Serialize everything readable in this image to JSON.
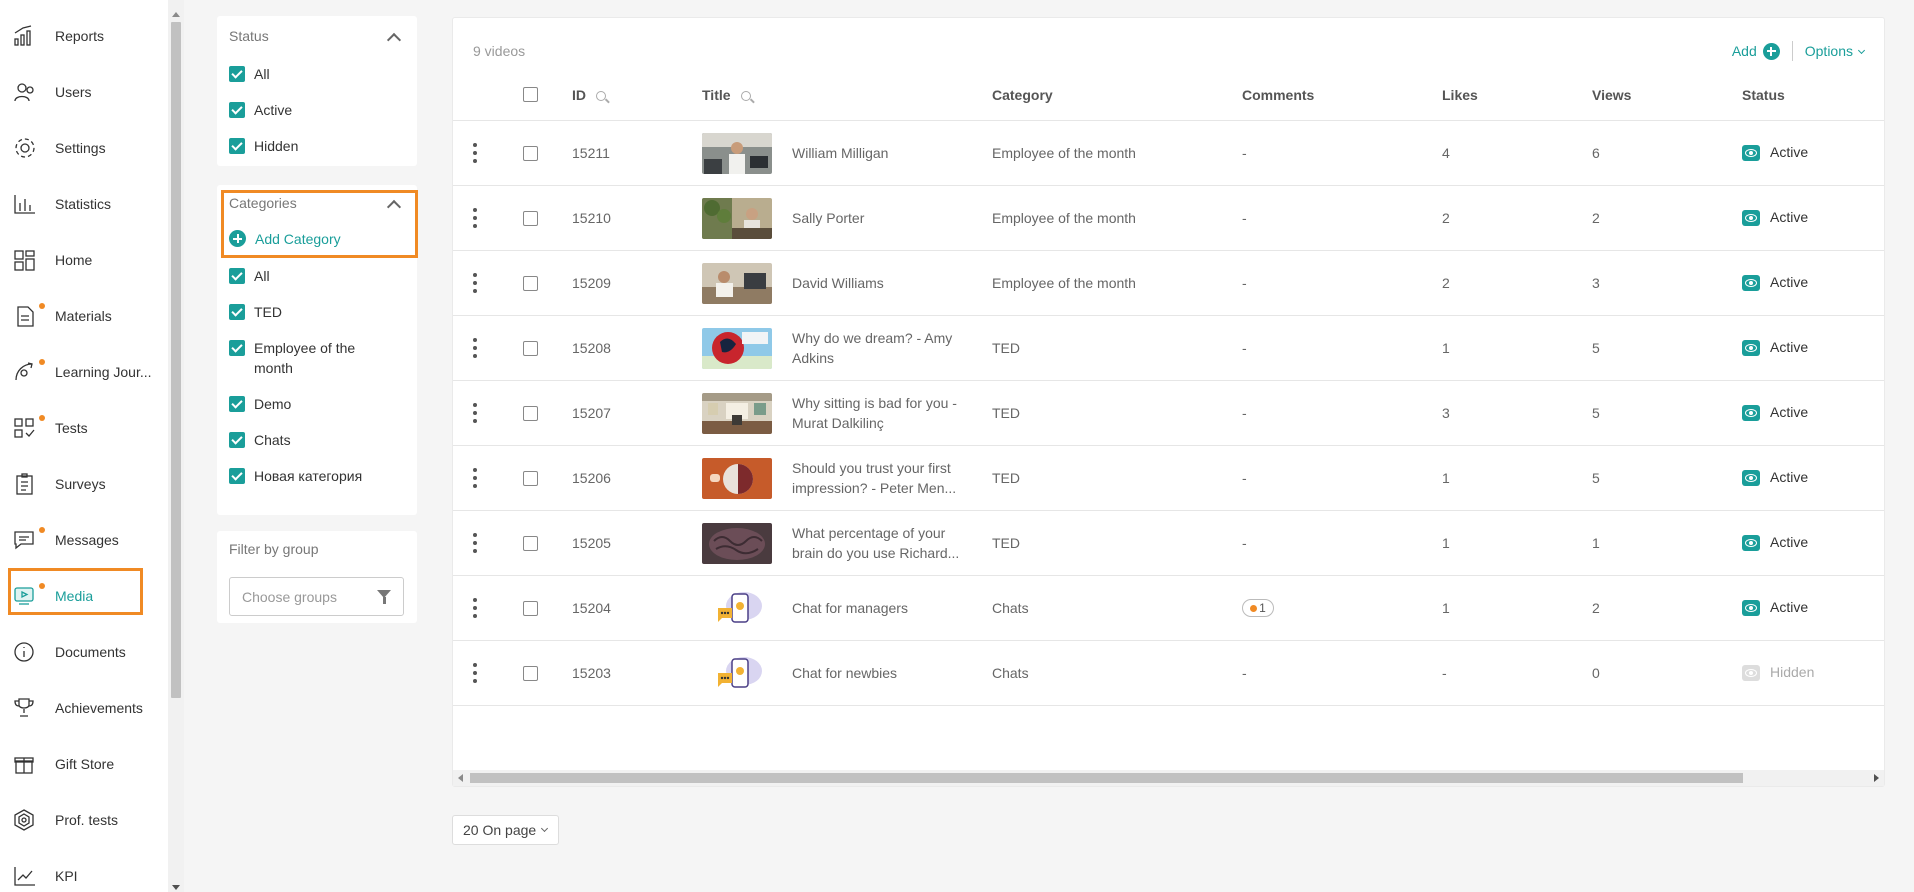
{
  "sidebar": {
    "items": [
      {
        "label": "Reports",
        "icon": "reports-icon",
        "dot": false
      },
      {
        "label": "Users",
        "icon": "users-icon",
        "dot": false
      },
      {
        "label": "Settings",
        "icon": "gear-icon",
        "dot": false
      },
      {
        "label": "Statistics",
        "icon": "bar-chart-icon",
        "dot": false
      },
      {
        "label": "Home",
        "icon": "home-layout-icon",
        "dot": false
      },
      {
        "label": "Materials",
        "icon": "materials-icon",
        "dot": true
      },
      {
        "label": "Learning Jour...",
        "icon": "learning-journey-icon",
        "dot": true
      },
      {
        "label": "Tests",
        "icon": "tests-icon",
        "dot": true
      },
      {
        "label": "Surveys",
        "icon": "surveys-icon",
        "dot": false
      },
      {
        "label": "Messages",
        "icon": "message-icon",
        "dot": true
      },
      {
        "label": "Media",
        "icon": "media-icon",
        "dot": true,
        "active": true
      },
      {
        "label": "Documents",
        "icon": "info-icon",
        "dot": false
      },
      {
        "label": "Achievements",
        "icon": "trophy-icon",
        "dot": false
      },
      {
        "label": "Gift Store",
        "icon": "gift-icon",
        "dot": false
      },
      {
        "label": "Prof. tests",
        "icon": "hexagon-icon",
        "dot": false
      },
      {
        "label": "KPI",
        "icon": "trend-icon",
        "dot": false
      }
    ]
  },
  "filters": {
    "status": {
      "title": "Status",
      "options": [
        "All",
        "Active",
        "Hidden"
      ]
    },
    "categories": {
      "title": "Categories",
      "add_label": "Add Category",
      "options": [
        "All",
        "TED",
        "Employee of the month",
        "Demo",
        "Chats",
        "Новая категория"
      ]
    },
    "group": {
      "title": "Filter by group",
      "placeholder": "Choose groups"
    }
  },
  "table": {
    "count": "9 videos",
    "add_label": "Add",
    "options_label": "Options",
    "columns": [
      "ID",
      "Title",
      "Category",
      "Comments",
      "Likes",
      "Views",
      "Status"
    ],
    "rows": [
      {
        "id": "15211",
        "title": "William Milligan",
        "category": "Employee of the month",
        "comments": "-",
        "likes": "4",
        "views": "6",
        "status": "Active",
        "thumb": "office"
      },
      {
        "id": "15210",
        "title": "Sally Porter",
        "category": "Employee of the month",
        "comments": "-",
        "likes": "2",
        "views": "2",
        "status": "Active",
        "thumb": "plants"
      },
      {
        "id": "15209",
        "title": "David Williams",
        "category": "Employee of the month",
        "comments": "-",
        "likes": "2",
        "views": "3",
        "status": "Active",
        "thumb": "desk"
      },
      {
        "id": "15208",
        "title": "Why do we dream? - Amy Adkins",
        "category": "TED",
        "comments": "-",
        "likes": "1",
        "views": "5",
        "status": "Active",
        "thumb": "dream"
      },
      {
        "id": "15207",
        "title": "Why sitting is bad for you - Murat Dalkilinç",
        "category": "TED",
        "comments": "-",
        "likes": "3",
        "views": "5",
        "status": "Active",
        "thumb": "room"
      },
      {
        "id": "15206",
        "title": "Should you trust your first impression? - Peter Men...",
        "category": "TED",
        "comments": "-",
        "likes": "1",
        "views": "5",
        "status": "Active",
        "thumb": "impression"
      },
      {
        "id": "15205",
        "title": "What percentage of your brain do you use Richard...",
        "category": "TED",
        "comments": "-",
        "likes": "1",
        "views": "1",
        "status": "Active",
        "thumb": "brain"
      },
      {
        "id": "15204",
        "title": "Chat for managers",
        "category": "Chats",
        "comments": "1",
        "likes": "1",
        "views": "2",
        "status": "Active",
        "thumb": "chat"
      },
      {
        "id": "15203",
        "title": "Chat for newbies",
        "category": "Chats",
        "comments": "-",
        "likes": "-",
        "views": "0",
        "status": "Hidden",
        "thumb": "chat"
      }
    ]
  },
  "pagination": {
    "per_page_label": "20 On page"
  },
  "colors": {
    "accent": "#1a9e9a",
    "highlight": "#f08a24"
  }
}
